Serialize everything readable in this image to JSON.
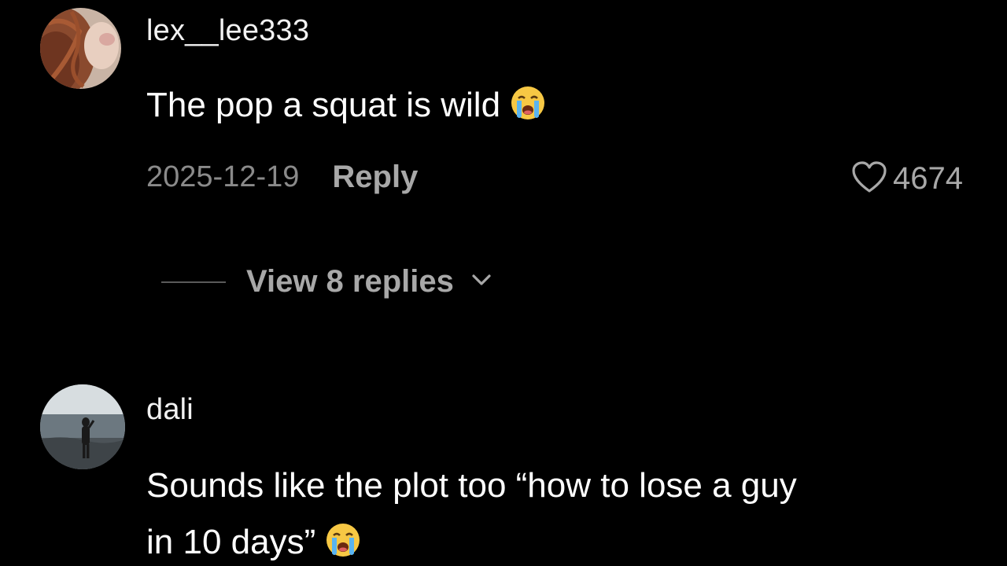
{
  "colors": {
    "background": "#000000",
    "text_primary": "#ffffff",
    "text_secondary": "#a8a8a8",
    "text_muted": "#8a8a8a"
  },
  "comments": [
    {
      "username": "lex__lee333",
      "text": "The pop a squat is wild",
      "emoji_icon": "loudly-crying-face-icon",
      "date": "2025-12-19",
      "reply_label": "Reply",
      "likes": "4674",
      "like_icon": "heart-outline-icon",
      "view_replies_label": "View 8 replies",
      "view_replies_icon": "chevron-down-icon"
    },
    {
      "username": "dali",
      "text_line1": "Sounds like the plot too “how to lose a guy",
      "text_line2": "in 10 days”",
      "emoji_icon": "loudly-crying-face-icon"
    }
  ]
}
